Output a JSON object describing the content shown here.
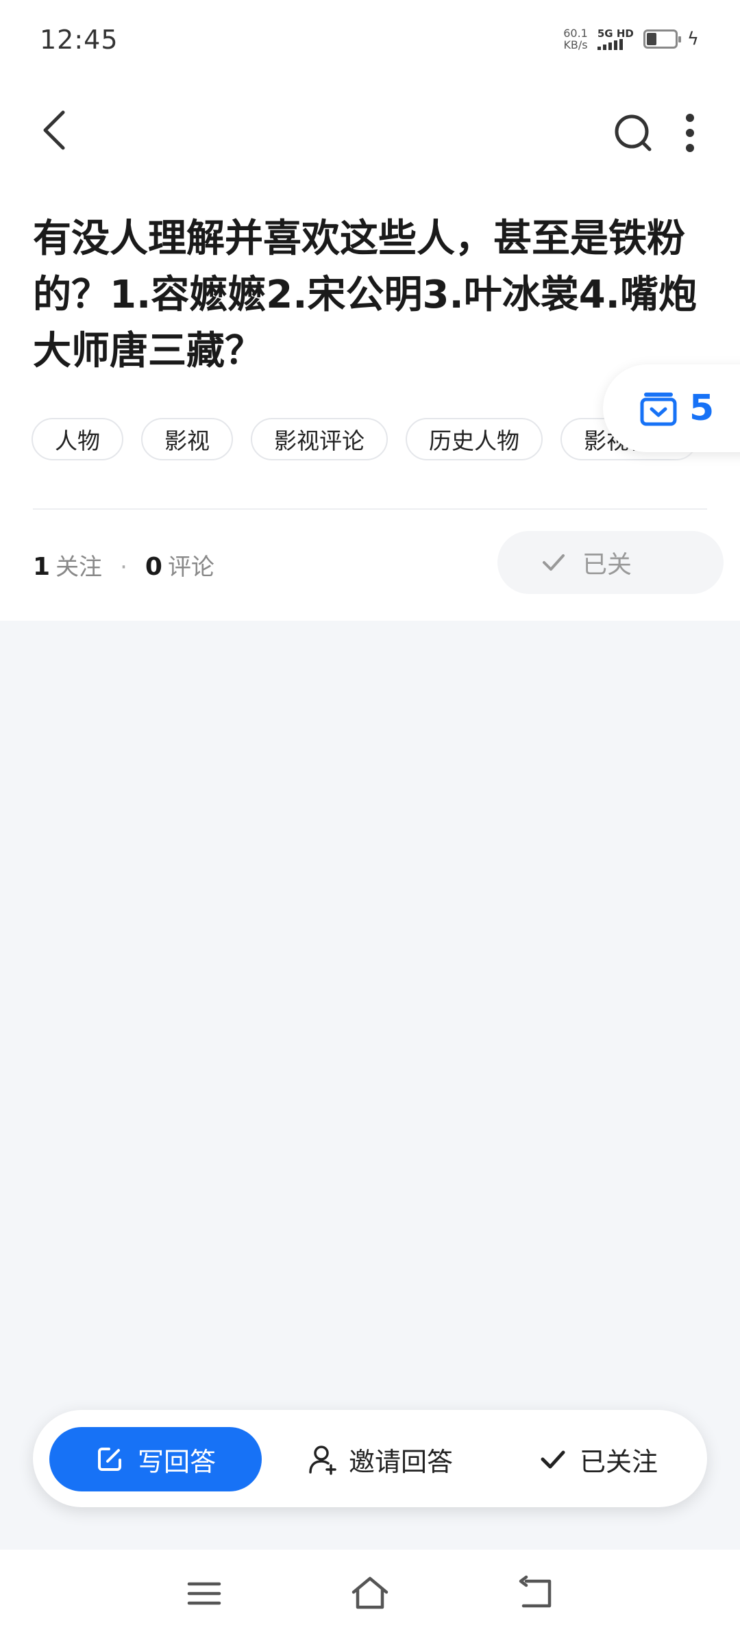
{
  "status_bar": {
    "time": "12:45",
    "net_speed_value": "60.1",
    "net_speed_unit": "KB/s",
    "signal_label": "5G HD"
  },
  "header": {
    "back_icon": "chevron-left-icon",
    "search_icon": "search-icon",
    "more_icon": "more-vertical-icon"
  },
  "question": {
    "title": "有没人理解并喜欢这些人，甚至是铁粉的？1.容嬷嬷2.宋公明3.叶冰裳4.嘴炮大师唐三藏？",
    "tags": [
      "人物",
      "影视",
      "影视评论",
      "历史人物",
      "影视作品"
    ],
    "stats": {
      "follow_count": "1",
      "follow_label": "关注",
      "dot": "·",
      "comment_count": "0",
      "comment_label": "评论"
    },
    "follow_pill_label": "已关"
  },
  "floating_badge": {
    "icon": "inbox-check-icon",
    "count": "5"
  },
  "action_bar": {
    "write_label": "写回答",
    "invite_label": "邀请回答",
    "followed_label": "已关注"
  },
  "nav_bar": {
    "menu_icon": "menu-icon",
    "home_icon": "home-icon",
    "back_icon": "back-icon"
  },
  "colors": {
    "accent": "#1772f6",
    "page_bg": "#f4f6f9",
    "card_bg": "#ffffff"
  }
}
